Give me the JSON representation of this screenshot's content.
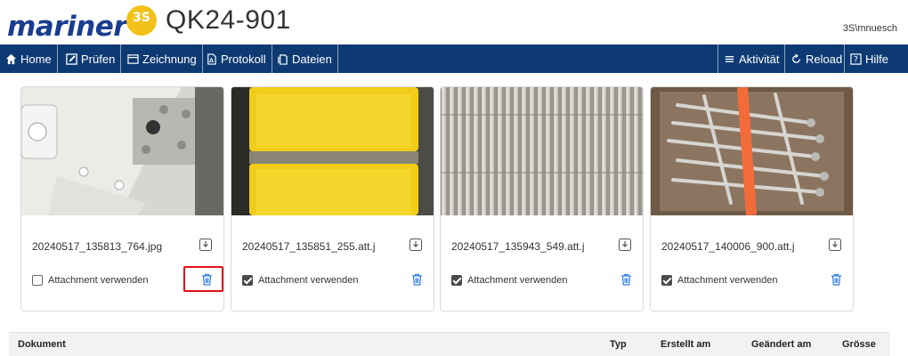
{
  "header": {
    "logo_text": "mariner",
    "logo_badge": "3S",
    "title": "QK24-901",
    "user": "3S\\mnuesch"
  },
  "navbar": {
    "left": [
      {
        "label": "Home",
        "icon": "home-icon"
      },
      {
        "label": "Prüfen",
        "icon": "edit-icon"
      },
      {
        "label": "Zeichnung",
        "icon": "drawing-icon"
      },
      {
        "label": "Protokoll",
        "icon": "pdf-icon"
      },
      {
        "label": "Dateien",
        "icon": "file-icon"
      }
    ],
    "right": [
      {
        "label": "Aktivität",
        "icon": "list-icon"
      },
      {
        "label": "Reload",
        "icon": "reload-icon"
      },
      {
        "label": "Hilfe",
        "icon": "help-icon"
      }
    ]
  },
  "attachments": [
    {
      "filename": "20240517_135813_764.jpg",
      "checkbox_label": "Attachment verwenden",
      "checked": false
    },
    {
      "filename": "20240517_135851_255.att.j",
      "checkbox_label": "Attachment verwenden",
      "checked": true
    },
    {
      "filename": "20240517_135943_549.att.j",
      "checkbox_label": "Attachment verwenden",
      "checked": true
    },
    {
      "filename": "20240517_140006_900.att.j",
      "checkbox_label": "Attachment verwenden",
      "checked": true
    }
  ],
  "table": {
    "columns": [
      "Dokument",
      "Typ",
      "Erstellt am",
      "Geändert am",
      "Grösse"
    ]
  },
  "colors": {
    "navbar": "#0d3a73",
    "brand": "#1a3d8f",
    "accent": "#f2c21b",
    "trash": "#2f7fe0",
    "highlight": "#e0101a"
  }
}
